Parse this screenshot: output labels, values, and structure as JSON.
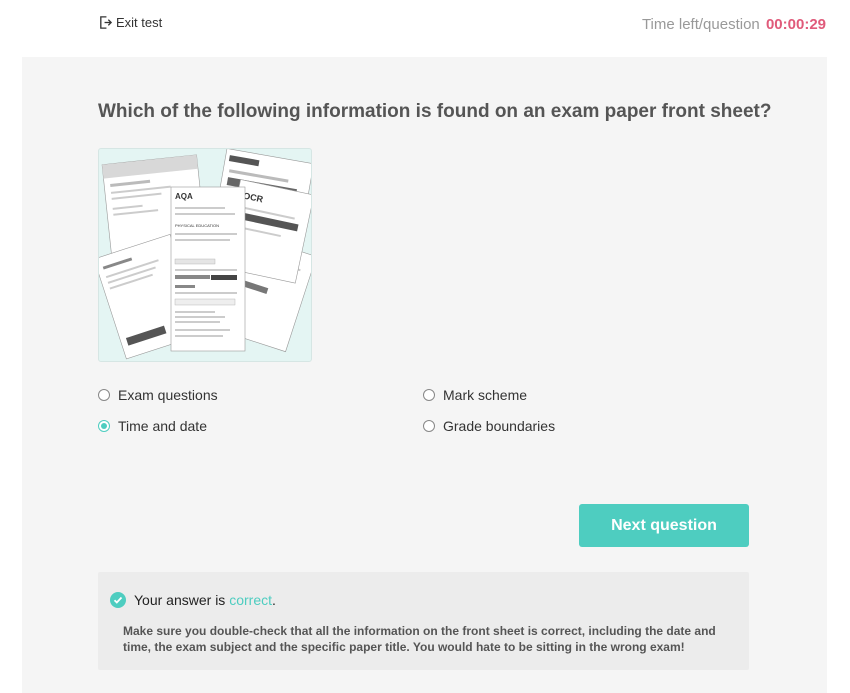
{
  "header": {
    "exit_label": "Exit test",
    "timer_label": "Time left/question",
    "timer_value": "00:00:29"
  },
  "question": {
    "text": "Which of the following information is found on an exam paper front sheet?",
    "image_icon": "exam-papers-collage"
  },
  "options": [
    {
      "label": "Exam questions",
      "selected": false
    },
    {
      "label": "Mark scheme",
      "selected": false
    },
    {
      "label": "Time and date",
      "selected": true
    },
    {
      "label": "Grade boundaries",
      "selected": false
    }
  ],
  "next_button": {
    "label": "Next question"
  },
  "feedback": {
    "prefix": "Your answer is ",
    "status": "correct",
    "suffix": ".",
    "body": "Make sure you double-check that all the information on the front sheet is correct, including the date and time, the exam subject and the specific paper title. You would hate to be sitting in the wrong exam!"
  },
  "colors": {
    "accent": "#4ecdc0",
    "timer": "#e05a7a",
    "card_background": "#f5f5f5"
  }
}
